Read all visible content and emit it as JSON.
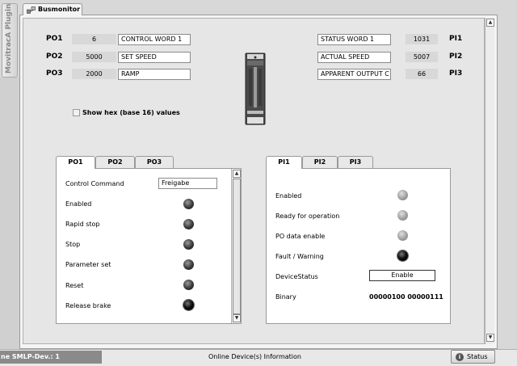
{
  "app": {
    "vertical_tab": "MovitracA Plugin",
    "tab_title": "Busmonitor"
  },
  "po": [
    {
      "label": "PO1",
      "value": "6",
      "name": "CONTROL WORD 1"
    },
    {
      "label": "PO2",
      "value": "5000",
      "name": "SET SPEED"
    },
    {
      "label": "PO3",
      "value": "2000",
      "name": "RAMP"
    }
  ],
  "pi": [
    {
      "label": "PI1",
      "value": "1031",
      "name": "STATUS WORD 1"
    },
    {
      "label": "PI2",
      "value": "5007",
      "name": "ACTUAL SPEED"
    },
    {
      "label": "PI3",
      "value": "66",
      "name": "APPARENT OUTPUT C"
    }
  ],
  "hex_checkbox": {
    "label": "Show hex (base 16) values",
    "checked": false
  },
  "po_panel": {
    "tabs": [
      "PO1",
      "PO2",
      "PO3"
    ],
    "active_tab": 0,
    "command_label": "Control Command",
    "command_value": "Freigabe",
    "rows": [
      {
        "label": "Enabled",
        "state": "dark"
      },
      {
        "label": "Rapid stop",
        "state": "dark"
      },
      {
        "label": "Stop",
        "state": "dark"
      },
      {
        "label": "Parameter set",
        "state": "dark"
      },
      {
        "label": "Reset",
        "state": "dark"
      },
      {
        "label": "Release brake",
        "state": "black"
      }
    ]
  },
  "pi_panel": {
    "tabs": [
      "PI1",
      "PI2",
      "PI3"
    ],
    "active_tab": 0,
    "rows": [
      {
        "label": "Enabled",
        "state": "grey"
      },
      {
        "label": "Ready for operation",
        "state": "grey"
      },
      {
        "label": "PO data enable",
        "state": "grey"
      },
      {
        "label": "Fault / Warning",
        "state": "black"
      }
    ],
    "device_status_label": "DeviceStatus",
    "device_status_value": "Enable",
    "binary_label": "Binary",
    "binary_value": "00000100 00000111"
  },
  "statusbar": {
    "left_text": "ne SMLP-Dev.: 1",
    "center_text": "Online Device(s) Information",
    "status_button": "Status"
  },
  "colors": {
    "led_dark": "#383838",
    "led_black": "#000000",
    "led_grey": "#9a9a9a",
    "status_left_bg": "#8a8a8a"
  }
}
